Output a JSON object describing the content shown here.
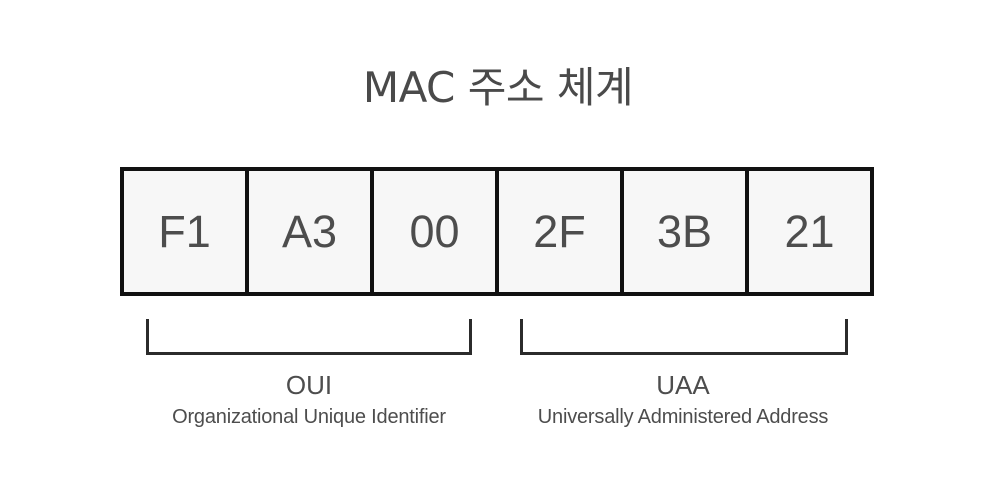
{
  "title": "MAC 주소 체계",
  "octets": [
    "F1",
    "A3",
    "00",
    "2F",
    "3B",
    "21"
  ],
  "groups": {
    "oui": {
      "label": "OUI",
      "description": "Organizational Unique Identifier"
    },
    "uaa": {
      "label": "UAA",
      "description": "Universally Administered Address"
    }
  }
}
